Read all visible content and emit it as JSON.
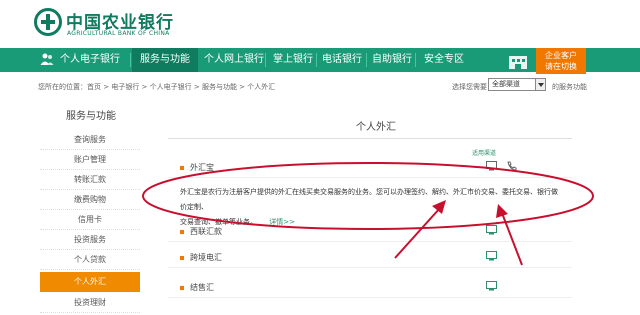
{
  "brand": {
    "name_cn": "中国农业银行",
    "name_en": "AGRICULTURAL BANK OF CHINA",
    "color": "#0f7c5f"
  },
  "nav": {
    "items": [
      {
        "label": "个人电子银行",
        "active": false
      },
      {
        "label": "服务与功能",
        "active": true
      },
      {
        "label": "个人网上银行",
        "active": false
      },
      {
        "label": "掌上银行",
        "active": false
      },
      {
        "label": "电话银行",
        "active": false
      },
      {
        "label": "自助银行",
        "active": false
      },
      {
        "label": "安全专区",
        "active": false
      }
    ],
    "promo_line1": "企业客户",
    "promo_line2": "请在切换",
    "bar_color": "#1a9b78",
    "promo_color": "#f07800"
  },
  "breadcrumb": "您所在的位置：首页 > 电子银行 > 个人电子银行 > 服务与功能 > 个人外汇",
  "channel": {
    "label": "选择您需要",
    "selected": "全部渠道",
    "link": "的服务功能"
  },
  "sidebar": {
    "title": "服务与功能",
    "items": [
      {
        "label": "查询服务",
        "active": false
      },
      {
        "label": "账户管理",
        "active": false
      },
      {
        "label": "转账汇款",
        "active": false
      },
      {
        "label": "缴费购物",
        "active": false
      },
      {
        "label": "信用卡",
        "active": false
      },
      {
        "label": "投资服务",
        "active": false
      },
      {
        "label": "个人贷款",
        "active": false
      },
      {
        "label": "个人外汇",
        "active": true
      },
      {
        "label": "投资理财",
        "active": false
      }
    ],
    "active_color": "#f08a00"
  },
  "main": {
    "title": "个人外汇",
    "section_head": "适用渠道",
    "rows": [
      {
        "label": "外汇宝",
        "icons": [
          "monitor-icon",
          "phone-icon"
        ]
      },
      {
        "label": "西联汇款",
        "icons": [
          "monitor-icon"
        ]
      },
      {
        "label": "跨境电汇",
        "icons": [
          "monitor-icon"
        ]
      },
      {
        "label": "结售汇",
        "icons": [
          "monitor-icon"
        ]
      }
    ],
    "description_line1": "外汇宝是农行为注册客户提供的外汇在线买卖交易服务的业务。您可以办理签约、解约、外汇市价交易、委托交易、银行做价定制、",
    "description_line2": "交易查询、撤单等业务。",
    "detail_link": "详情>>"
  },
  "annotation_color": "#c8102e"
}
